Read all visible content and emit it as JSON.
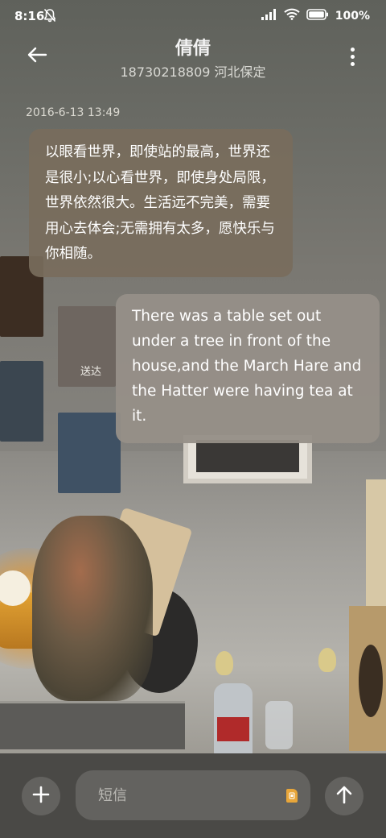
{
  "status_bar": {
    "time": "8:16",
    "battery_text": "100%",
    "icons": [
      "mute-bell-icon",
      "signal-icon",
      "wifi-icon",
      "battery-icon"
    ]
  },
  "header": {
    "back_icon": "arrow-left-icon",
    "contact_name": "倩倩",
    "contact_info": "18730218809 河北保定",
    "more_icon": "more-vertical-icon"
  },
  "messages": {
    "timestamp": "2016-6-13 13:49",
    "incoming": {
      "text": "以眼看世界，即使站的最高，世界还是很小;以心看世界，即使身处局限，世界依然很大。生活远不完美，需要用心去体会;无需拥有太多，愿快乐与你相随。"
    },
    "outgoing": {
      "text": "There was a table set out under a tree in front of the house,and the March Hare and the Hatter were having tea at it.",
      "status": "送达"
    }
  },
  "input_bar": {
    "add_icon": "plus-icon",
    "placeholder": "短信",
    "sim_icon": "sim-card-icon",
    "send_icon": "arrow-up-icon"
  }
}
